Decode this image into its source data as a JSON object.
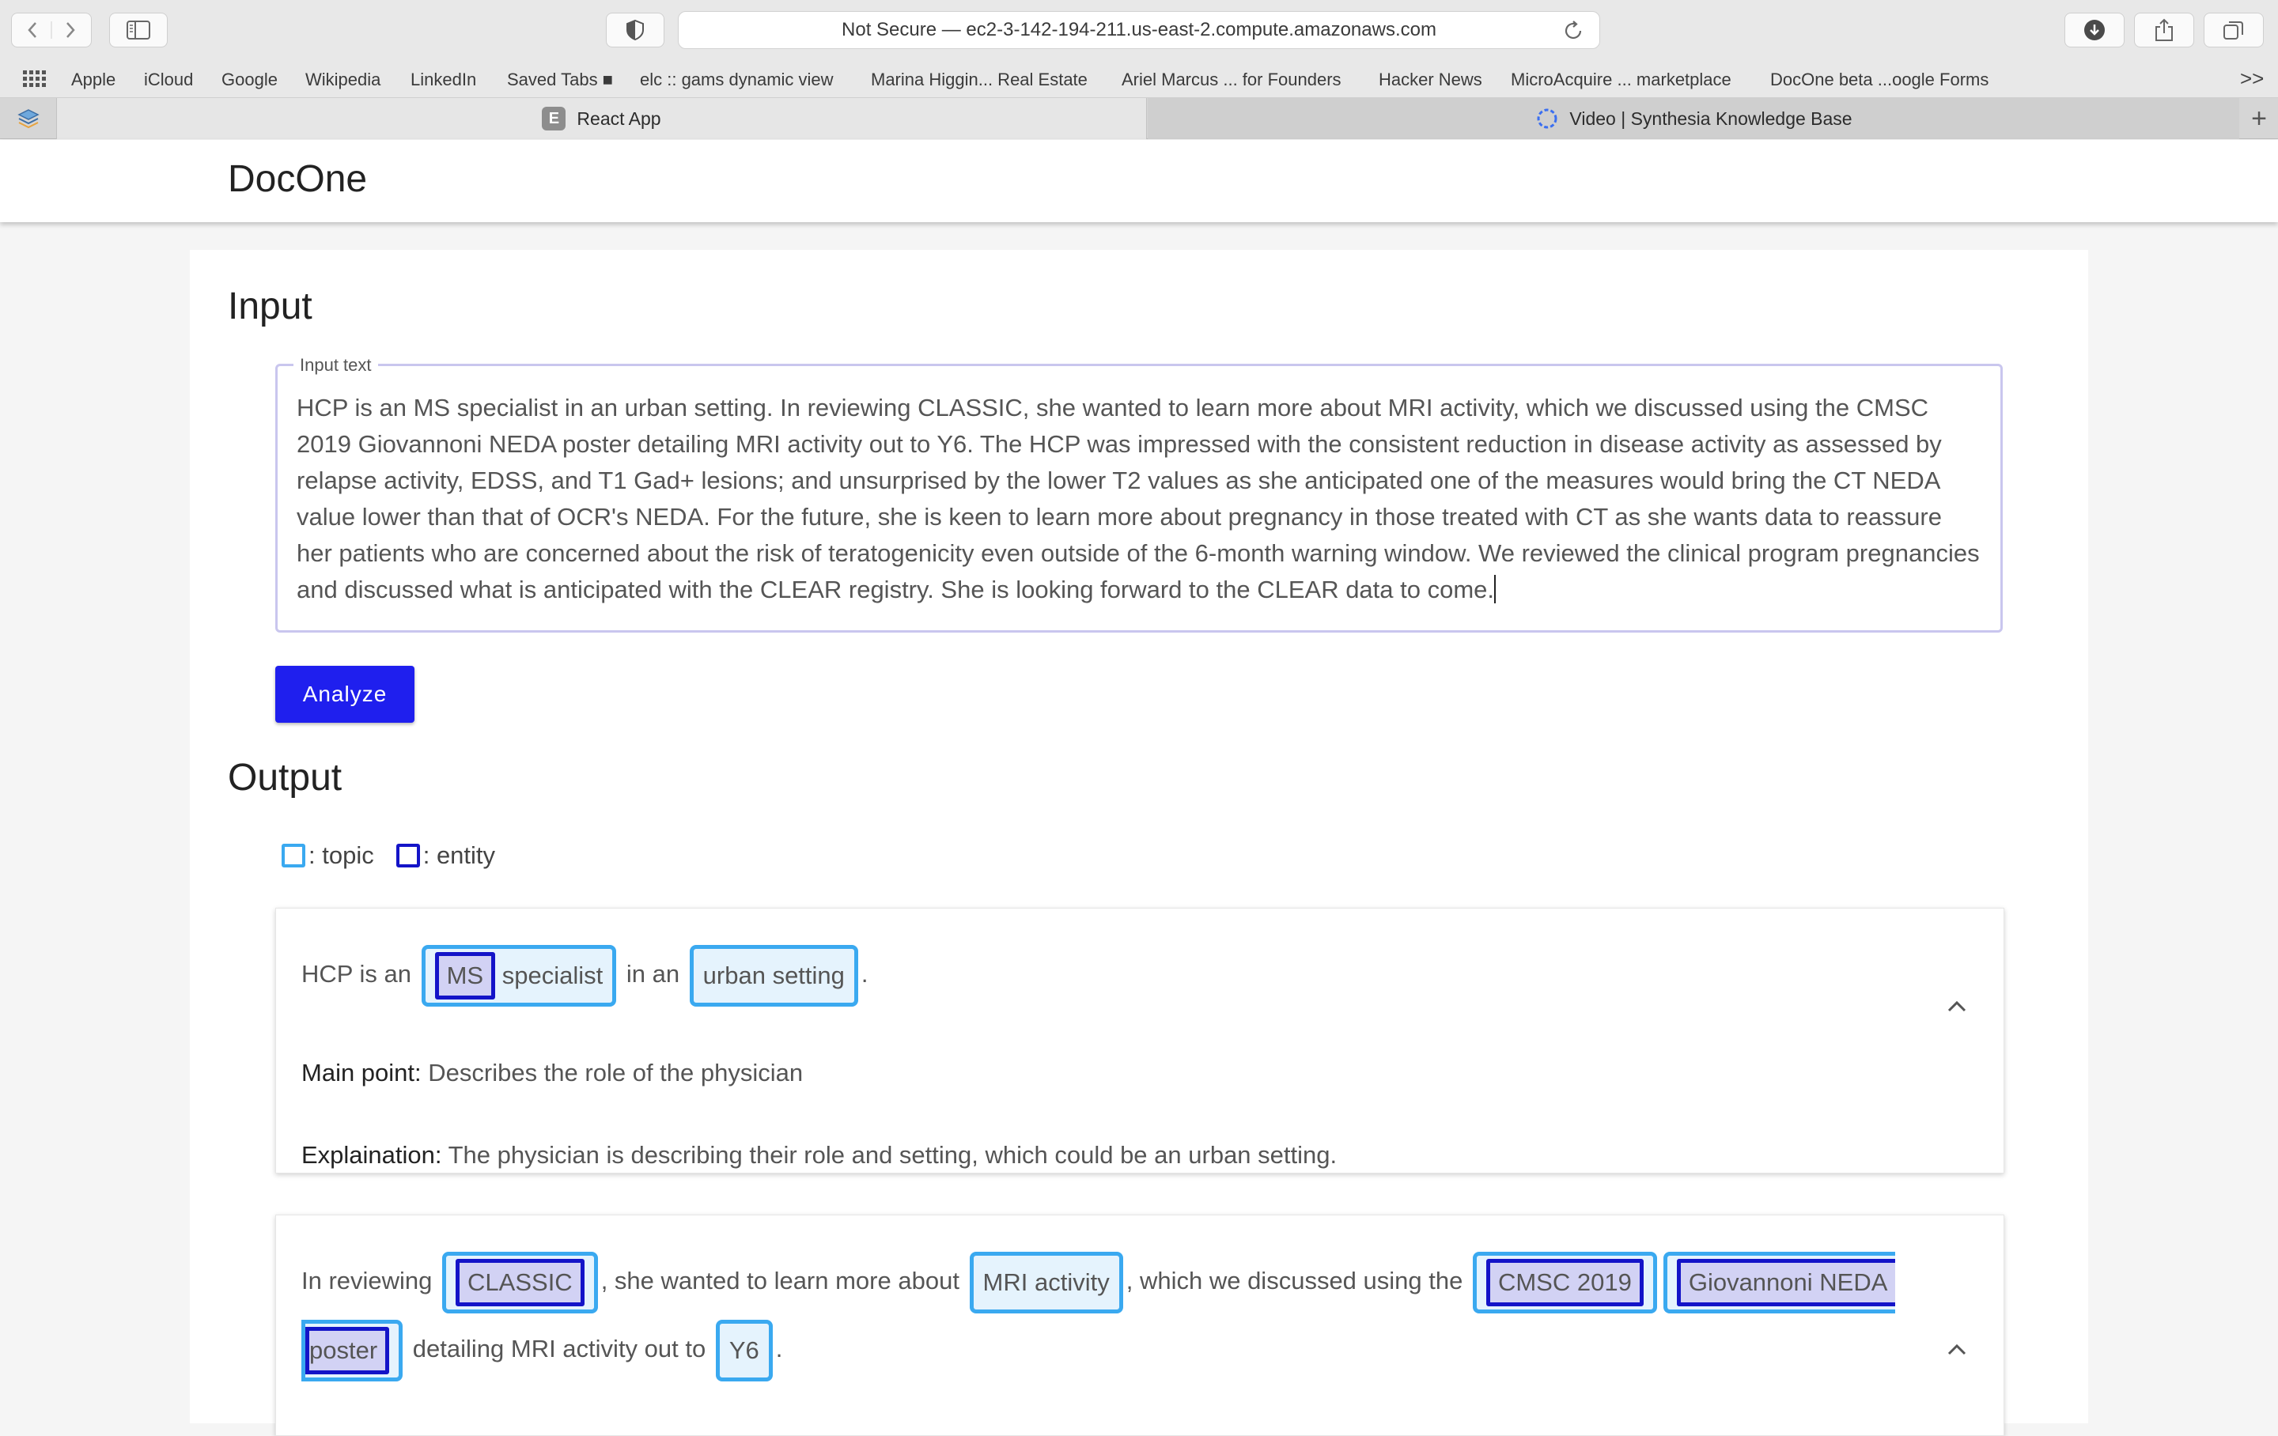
{
  "browser": {
    "address": "Not Secure — ec2-3-142-194-211.us-east-2.compute.amazonaws.com",
    "bookmarks": [
      "Apple",
      "iCloud",
      "Google",
      "Wikipedia",
      "LinkedIn",
      "Saved Tabs ■",
      "elc :: gams dynamic view",
      "Marina Higgin... Real Estate",
      "Ariel Marcus ... for Founders",
      "Hacker News",
      "MicroAcquire ... marketplace",
      "DocOne beta ...oogle Forms"
    ],
    "more": ">>",
    "tabs": [
      {
        "label": "React App",
        "favicon": "E"
      },
      {
        "label": "Video | Synthesia Knowledge Base"
      }
    ],
    "add_tab": "+"
  },
  "app": {
    "brand": "DocOne",
    "input_title": "Input",
    "field_label": "Input text",
    "input_text": "HCP is an MS specialist in an urban setting. In reviewing CLASSIC, she wanted to learn more about MRI activity, which we discussed using the CMSC 2019 Giovannoni NEDA poster detailing MRI activity out to Y6. The HCP was impressed with the consistent reduction in disease activity as assessed by relapse activity, EDSS, and T1 Gad+ lesions; and unsurprised by the lower T2 values as she anticipated one of the measures would bring the CT NEDA value lower than that of OCR's NEDA. For the future, she is keen to learn more about pregnancy in those treated with CT as she wants data to reassure her patients who are concerned about the risk of teratogenicity even outside of the 6-month warning window. We reviewed the clinical program pregnancies and discussed what is anticipated with the CLEAR registry. She is looking forward to the CLEAR data to come.",
    "analyze_label": "Analyze",
    "output_title": "Output",
    "legend": {
      "topic": ": topic",
      "entity": ": entity"
    },
    "colors": {
      "topic": "#3aa9f0",
      "entity": "#1414c8",
      "button": "#1f1fee"
    }
  },
  "cards": [
    {
      "t1": "HCP is an ",
      "e_ms": "MS",
      "topic_ms_rest": " specialist",
      "t2": " in an ",
      "topic_urban": "urban setting",
      "t3": ".",
      "main_label": "Main point:",
      "main_value": " Describes the role of the physician",
      "expl_label": "Explaination:",
      "expl_value": " The physician is describing their role and setting, which could be an urban setting."
    },
    {
      "t1": "In reviewing ",
      "e_classic": "CLASSIC",
      "t2": ", she wanted to learn more about ",
      "topic_mri": "MRI activity",
      "t3": ", which we discussed using the ",
      "e_cmsc": "CMSC 2019",
      "e_gio_a": "Giovannoni NEDA",
      "e_gio_b": "poster",
      "t4": " detailing MRI activity out to ",
      "topic_y6": "Y6",
      "t5": "."
    }
  ]
}
